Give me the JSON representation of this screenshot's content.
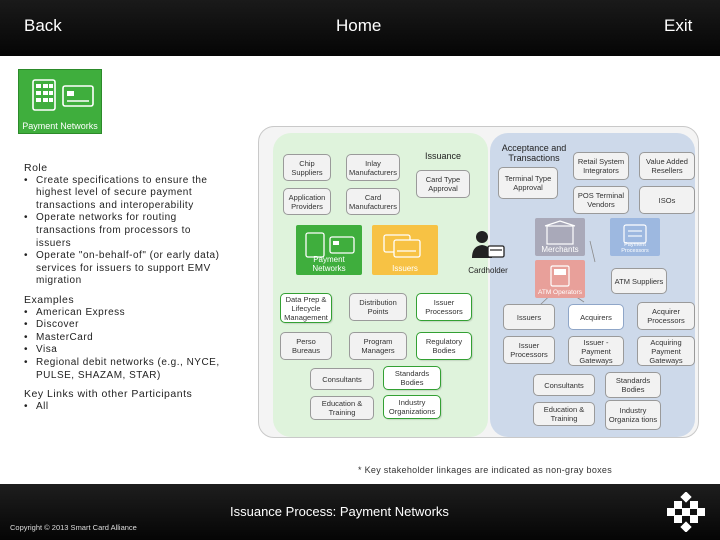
{
  "nav": {
    "back": "Back",
    "home": "Home",
    "exit": "Exit"
  },
  "tile_label": "Payment Networks",
  "left": {
    "role_heading": "Role",
    "role_items": [
      "Create specifications to ensure the highest level of secure payment transactions and interoperability",
      "Operate networks for routing transactions from processors to issuers",
      "Operate \"on-behalf-of\" (or early data) services for issuers to support EMV migration"
    ],
    "examples_heading": "Examples",
    "examples_items": [
      "American Express",
      "Discover",
      "MasterCard",
      "Visa",
      "Regional debit networks (e.g., NYCE, PULSE, SHAZAM, STAR)"
    ],
    "links_heading": "Key Links with other Participants",
    "links_items": [
      "All"
    ]
  },
  "diagram": {
    "issuance_label": "Issuance",
    "acceptance_label": "Acceptance and Transactions",
    "cardholder_label": "Cardholder",
    "green_boxes": {
      "chip_suppliers": "Chip Suppliers",
      "inlay_manufacturers": "Inlay Manufacturers",
      "application_providers": "Application Providers",
      "card_manufacturers": "Card Manufacturers",
      "card_type_approval": "Card Type Approval",
      "data_prep": "Data Prep & Lifecycle Management",
      "distribution_points": "Distribution Points",
      "issuer_processors": "Issuer Processors",
      "perso_bureaus": "Perso Bureaus",
      "program_managers": "Program Managers",
      "regulatory_bodies": "Regulatory Bodies",
      "consultants": "Consultants",
      "standards_bodies": "Standards Bodies",
      "education_training": "Education & Training",
      "industry_organizations": "Industry Organizations"
    },
    "blue_boxes": {
      "terminal_type_approval": "Terminal Type Approval",
      "retail_system_integrators": "Retail System Integrators",
      "value_added_resellers": "Value Added Resellers",
      "pos_terminal_vendors": "POS Terminal Vendors",
      "isos": "ISOs",
      "atm_suppliers": "ATM Suppliers",
      "issuers": "Issuers",
      "acquirers": "Acquirers",
      "acquirer_processors": "Acquirer Processors",
      "issuer_processors": "Issuer Processors",
      "issuer_payment_gateways": "Issuer -Payment Gateways",
      "acquiring_payment_gateways": "Acquiring Payment Gateways",
      "consultants": "Consultants",
      "standards_bodies": "Standards Bodies",
      "education_training": "Education & Training",
      "industry_organizations": "Industry Organiza tions"
    },
    "tiles": {
      "payment_networks": "Payment Networks",
      "issuers": "Issuers",
      "merchants": "Merchants",
      "payment_processors": "Payment Processors",
      "atm_operators": "ATM Operators"
    }
  },
  "footnote": "* Key stakeholder linkages are indicated as non-gray boxes",
  "bottom": {
    "title": "Issuance Process: Payment Networks",
    "copyright": "Copyright © 2013 Smart Card Alliance"
  },
  "colors": {
    "bar_background": "#0b0b0b",
    "payment_networks_green": "#3fae3d",
    "issuers_yellow": "#f7c244",
    "merchants_gray": "#a9a9b9",
    "payment_processors_blue": "#9db8e0",
    "atm_operators_red": "#e8a09a",
    "green_border": "#33a033",
    "issuance_panel": "#dff3dc",
    "acceptance_panel": "#cdd9ea"
  }
}
